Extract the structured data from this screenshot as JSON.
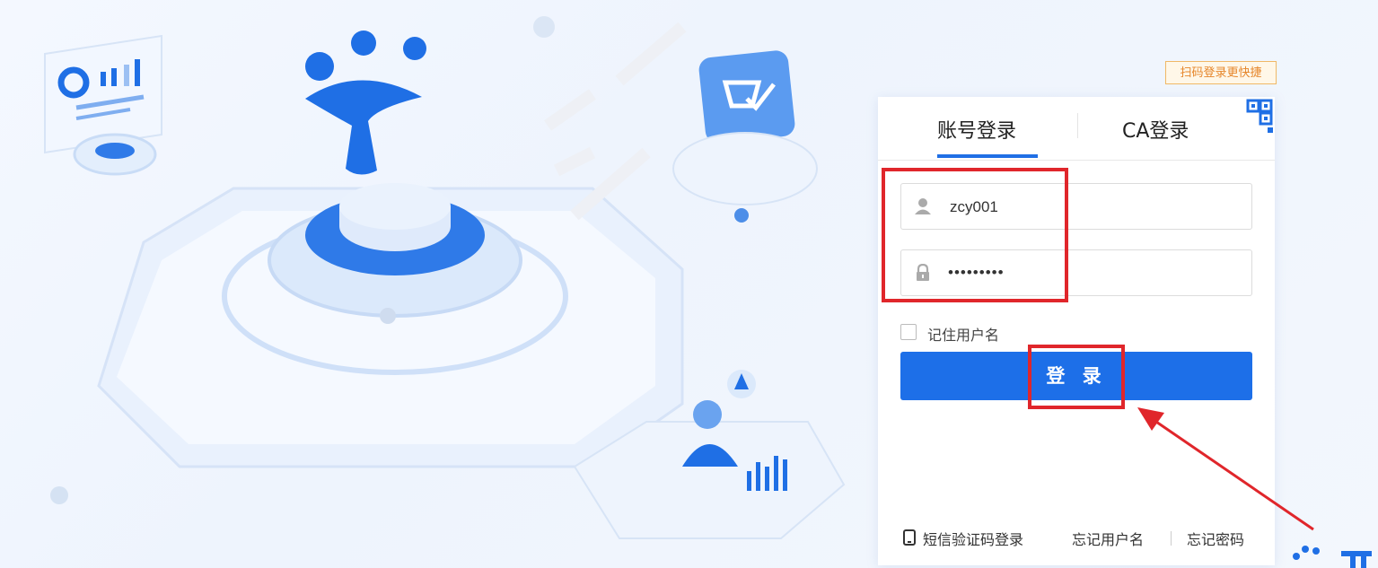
{
  "scan_tip": "扫码登录更快捷",
  "tabs": [
    {
      "label": "账号登录",
      "active": true
    },
    {
      "label": "CA登录",
      "active": false
    }
  ],
  "username": {
    "value": "zcy001"
  },
  "password": {
    "value": "•••••••••"
  },
  "remember_label": "记住用户名",
  "login_button": "登 录",
  "footer": {
    "sms_login": "短信验证码登录",
    "forgot_username": "忘记用户名",
    "forgot_password": "忘记密码"
  },
  "colors": {
    "primary": "#1d6fe8",
    "highlight": "#e0262b",
    "tip_border": "#f0b866"
  },
  "icons": [
    "user-icon",
    "lock-icon",
    "qr-code-icon",
    "phone-icon",
    "arrow-annotation-icon"
  ]
}
